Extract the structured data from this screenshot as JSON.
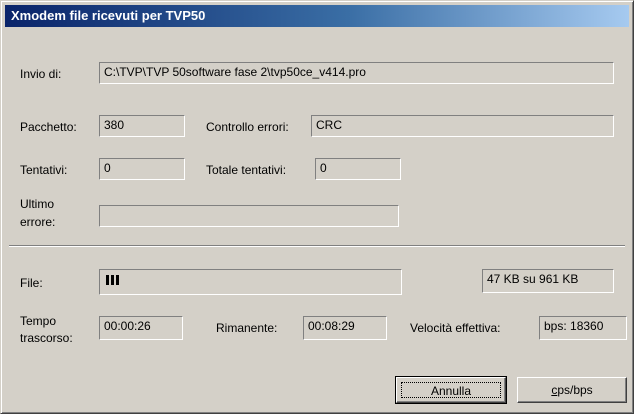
{
  "window": {
    "title": "Xmodem file ricevuti per TVP50"
  },
  "rows": {
    "invio": {
      "label": "Invio di:",
      "value": "C:\\TVP\\TVP 50software fase 2\\tvp50ce_v414.pro"
    },
    "pacchetto": {
      "label": "Pacchetto:",
      "value": "380"
    },
    "controllo_errori": {
      "label": "Controllo errori:",
      "value": "CRC"
    },
    "tentativi": {
      "label": "Tentativi:",
      "value": "0"
    },
    "totale_tentativi": {
      "label": "Totale tentativi:",
      "value": "0"
    },
    "ultimo_errore": {
      "label_line1": "Ultimo",
      "label_line2": "errore:",
      "value": ""
    }
  },
  "transfer": {
    "file_label": "File:",
    "progress_fraction": 0.049,
    "size_text": "47 KB su 961 KB",
    "tempo_label_line1": "Tempo",
    "tempo_label_line2": "trascorso:",
    "tempo_value": "00:00:26",
    "rimanente_label": "Rimanente:",
    "rimanente_value": "00:08:29",
    "velocita_label": "Velocità effettiva:",
    "velocita_value": "bps: 18360"
  },
  "buttons": {
    "annulla": "Annulla",
    "cps_first": "c",
    "cps_rest": "ps/bps"
  }
}
